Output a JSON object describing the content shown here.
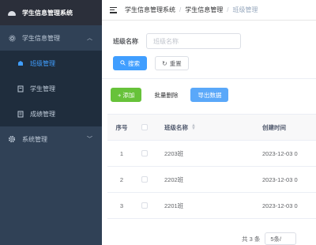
{
  "app": {
    "logo_text": "学生信息管理系统"
  },
  "sidebar": {
    "groups": [
      {
        "label": "学生信息管理",
        "expanded": true,
        "items": [
          {
            "label": "班级管理",
            "active": true,
            "icon": "class-icon"
          },
          {
            "label": "学生管理",
            "active": false,
            "icon": "student-icon"
          },
          {
            "label": "成绩管理",
            "active": false,
            "icon": "score-icon"
          }
        ]
      },
      {
        "label": "系统管理",
        "expanded": false
      }
    ]
  },
  "header": {
    "breadcrumbs": [
      "学生信息管理系统",
      "学生信息管理",
      "班级管理"
    ]
  },
  "search": {
    "label": "班级名称",
    "placeholder": "班级名称",
    "search_label": "搜索",
    "reset_label": "重置"
  },
  "toolbar": {
    "add_label": "+ 添加",
    "batch_delete_label": "批量删除",
    "export_label": "导出数据"
  },
  "table": {
    "columns": [
      "序号",
      "",
      "班级名称",
      "创建时间"
    ],
    "rows": [
      {
        "index": "1",
        "name": "2203班",
        "created": "2023-12-03 0"
      },
      {
        "index": "2",
        "name": "2202班",
        "created": "2023-12-03 0"
      },
      {
        "index": "3",
        "name": "2201班",
        "created": "2023-12-03 0"
      }
    ]
  },
  "pagination": {
    "total_text": "共 3 条",
    "page_size_text": "5条/"
  },
  "colors": {
    "sidebar_bg": "#304156",
    "active": "#409eff",
    "success": "#67c23a"
  }
}
